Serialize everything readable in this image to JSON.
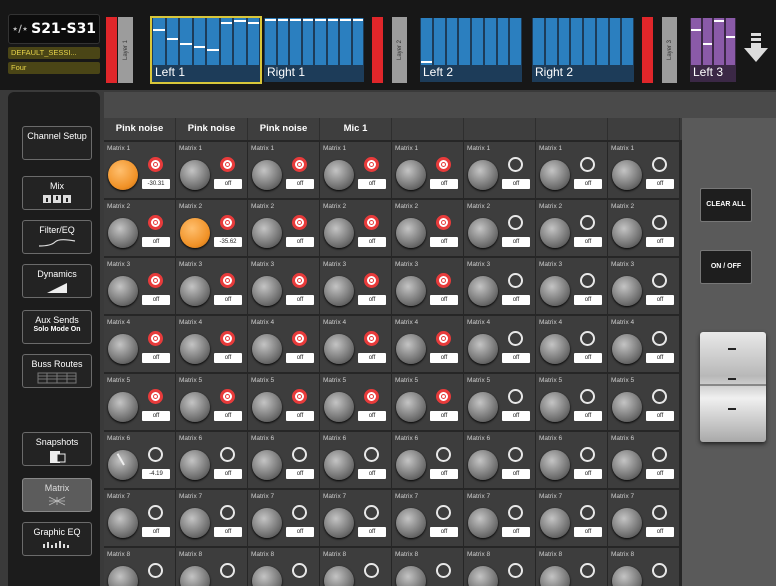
{
  "device": {
    "name": "S21-S31",
    "symbol": "⋆∕⋆",
    "session": "DEFAULT_SESSI...",
    "scene": "Four"
  },
  "layers": [
    {
      "label": "Layer 1",
      "banks": [
        {
          "label": "Left 1",
          "selected": true,
          "levels": [
            0.75,
            0.55,
            0.45,
            0.38,
            0.3,
            0.9,
            0.95,
            0.92
          ]
        },
        {
          "label": "Right 1",
          "selected": false,
          "levels": [
            0.97,
            0.97,
            0.97,
            0.97,
            0.97,
            0.97,
            0.97,
            0.97
          ]
        }
      ]
    },
    {
      "label": "Layer 2",
      "banks": [
        {
          "label": "Left 2",
          "selected": false,
          "levels": [
            0.05,
            0,
            0,
            0,
            0,
            0,
            0,
            0
          ]
        },
        {
          "label": "Right 2",
          "selected": false,
          "levels": [
            0,
            0,
            0,
            0,
            0,
            0,
            0,
            0
          ]
        }
      ]
    },
    {
      "label": "Layer 3",
      "banks": [
        {
          "label": "Left 3",
          "selected": false,
          "levels": [
            0.75,
            0.45,
            0.95,
            0.6
          ]
        }
      ]
    }
  ],
  "sidebar": [
    {
      "label": "Channel Setup",
      "icon": "none"
    },
    {
      "label": "Mix",
      "icon": "mix-icon"
    },
    {
      "label": "Filter/EQ",
      "icon": "eq-curve-icon"
    },
    {
      "label": "Dynamics",
      "icon": "dynamics-icon"
    },
    {
      "label": "Aux Sends",
      "sub": "Solo Mode On",
      "icon": "none"
    },
    {
      "label": "Buss Routes",
      "icon": "grid-icon"
    },
    {
      "label": "Snapshots",
      "icon": "snapshot-icon"
    },
    {
      "label": "Matrix",
      "icon": "matrix-icon",
      "active": true
    },
    {
      "label": "Graphic EQ",
      "icon": "graphic-eq-icon"
    }
  ],
  "channels": [
    "Pink noise",
    "Pink noise",
    "Pink noise",
    "Mic 1",
    "",
    "",
    "",
    ""
  ],
  "matrix_rows": [
    {
      "name": "Matrix 1",
      "cells": [
        {
          "on": true,
          "red": true,
          "val": "-30.31"
        },
        {
          "red": true,
          "val": "off"
        },
        {
          "red": true,
          "val": "off"
        },
        {
          "red": true,
          "val": "off"
        },
        {
          "red": true,
          "val": "off"
        },
        {
          "val": "off"
        },
        {
          "val": "off"
        },
        {
          "val": "off"
        }
      ]
    },
    {
      "name": "Matrix 2",
      "cells": [
        {
          "red": true,
          "val": "off"
        },
        {
          "on": true,
          "red": true,
          "val": "-35.62"
        },
        {
          "red": true,
          "val": "off"
        },
        {
          "red": true,
          "val": "off"
        },
        {
          "red": true,
          "val": "off"
        },
        {
          "val": "off"
        },
        {
          "val": "off"
        },
        {
          "val": "off"
        }
      ]
    },
    {
      "name": "Matrix 3",
      "cells": [
        {
          "red": true,
          "val": "off"
        },
        {
          "red": true,
          "val": "off"
        },
        {
          "red": true,
          "val": "off"
        },
        {
          "red": true,
          "val": "off"
        },
        {
          "red": true,
          "val": "off"
        },
        {
          "val": "off"
        },
        {
          "val": "off"
        },
        {
          "val": "off"
        }
      ]
    },
    {
      "name": "Matrix 4",
      "cells": [
        {
          "red": true,
          "val": "off"
        },
        {
          "red": true,
          "val": "off"
        },
        {
          "red": true,
          "val": "off"
        },
        {
          "red": true,
          "val": "off"
        },
        {
          "red": true,
          "val": "off"
        },
        {
          "val": "off"
        },
        {
          "val": "off"
        },
        {
          "val": "off"
        }
      ]
    },
    {
      "name": "Matrix 5",
      "cells": [
        {
          "red": true,
          "val": "off"
        },
        {
          "red": true,
          "val": "off"
        },
        {
          "red": true,
          "val": "off"
        },
        {
          "red": true,
          "val": "off"
        },
        {
          "red": true,
          "val": "off"
        },
        {
          "val": "off"
        },
        {
          "val": "off"
        },
        {
          "val": "off"
        }
      ]
    },
    {
      "name": "Matrix 6",
      "cells": [
        {
          "val": "-4.19",
          "needle": true
        },
        {
          "val": "off"
        },
        {
          "val": "off"
        },
        {
          "val": "off"
        },
        {
          "val": "off"
        },
        {
          "val": "off"
        },
        {
          "val": "off"
        },
        {
          "val": "off"
        }
      ]
    },
    {
      "name": "Matrix 7",
      "cells": [
        {
          "val": "off"
        },
        {
          "val": "off"
        },
        {
          "val": "off"
        },
        {
          "val": "off"
        },
        {
          "val": "off"
        },
        {
          "val": "off"
        },
        {
          "val": "off"
        },
        {
          "val": "off"
        }
      ]
    },
    {
      "name": "Matrix 8",
      "cells": [
        {
          "val": ""
        },
        {
          "val": ""
        },
        {
          "val": ""
        },
        {
          "val": ""
        },
        {
          "val": ""
        },
        {
          "val": ""
        },
        {
          "val": ""
        },
        {
          "val": ""
        }
      ]
    }
  ],
  "right_panel": {
    "clear_all": "CLEAR ALL",
    "on_off": "ON / OFF",
    "fader_marks": [
      "-",
      "-",
      "-"
    ]
  },
  "colors": {
    "accent_orange": "#f09126",
    "send_red": "#e83b3b",
    "bank_blue": "#2b7fbf",
    "layer_red": "#e0262a",
    "selection_yellow": "#d8c63a"
  }
}
